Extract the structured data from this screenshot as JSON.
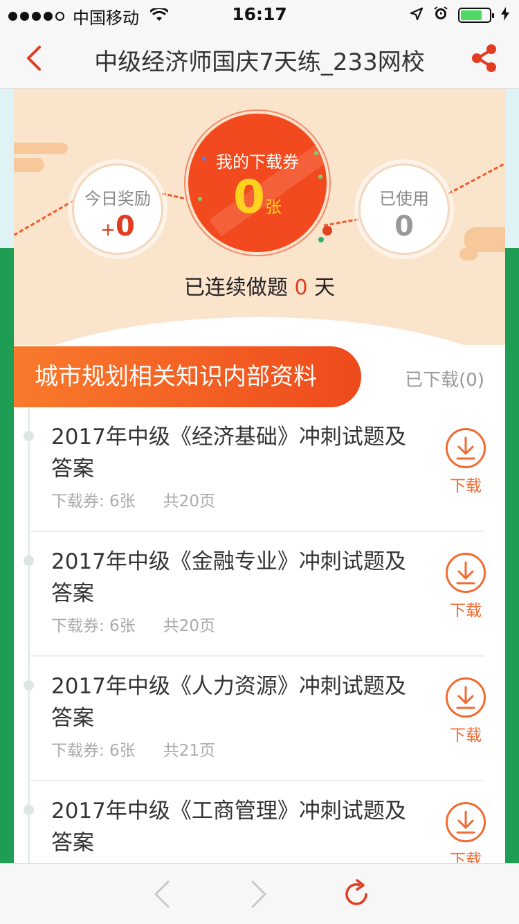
{
  "status_bar": {
    "carrier": "中国移动",
    "time": "16:17",
    "battery_level": 0.75,
    "signal_bars": 4
  },
  "nav": {
    "title": "中级经济师国庆7天练_233网校",
    "accent": "#e23b1f"
  },
  "stats": {
    "today_label": "今日奖励",
    "today_plus": "+",
    "today_value": "0",
    "my_label": "我的下载券",
    "my_value": "0",
    "my_unit": "张",
    "used_label": "已使用",
    "used_value": "0",
    "streak_prefix": "已连续做题",
    "streak_value": "0",
    "streak_suffix": "天"
  },
  "section": {
    "title": "城市规划相关知识内部资料",
    "downloaded": "已下载(0)"
  },
  "items": [
    {
      "title": "2017年中级《经济基础》冲刺试题及答案",
      "coupons": "下载券: 6张",
      "pages": "共20页",
      "action": "下载"
    },
    {
      "title": "2017年中级《金融专业》冲刺试题及答案",
      "coupons": "下载券: 6张",
      "pages": "共20页",
      "action": "下载"
    },
    {
      "title": "2017年中级《人力资源》冲刺试题及答案",
      "coupons": "下载券: 6张",
      "pages": "共21页",
      "action": "下载"
    },
    {
      "title": "2017年中级《工商管理》冲刺试题及答案",
      "coupons": "",
      "pages": "",
      "action": "下载"
    }
  ],
  "colors": {
    "orange": "#f26a30",
    "red": "#ee4a1c",
    "coin": "#ffd21f",
    "page_green": "#1f9d55"
  }
}
